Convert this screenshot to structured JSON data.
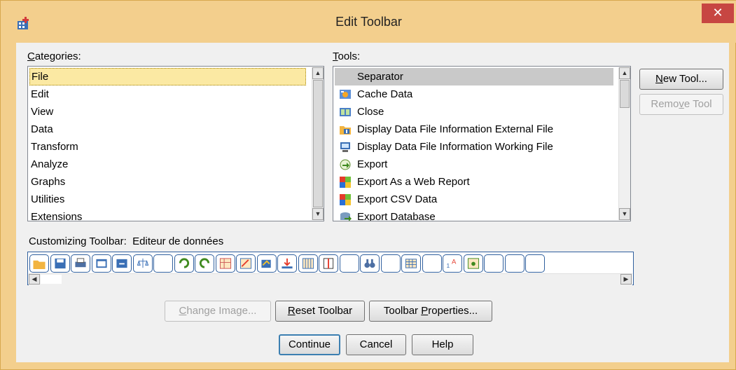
{
  "window": {
    "title": "Edit Toolbar",
    "close_glyph": "✕",
    "app_icon": "spss-toolbar-icon",
    "accent": "#f3cf8d"
  },
  "categories": {
    "label_underlined": "C",
    "label_rest": "ategories:",
    "items": [
      "File",
      "Edit",
      "View",
      "Data",
      "Transform",
      "Analyze",
      "Graphs",
      "Utilities",
      "Extensions"
    ],
    "selected": "File"
  },
  "tools": {
    "label_underlined": "T",
    "label_rest": "ools:",
    "items": [
      {
        "label": "Separator",
        "icon": "separator-icon"
      },
      {
        "label": "Cache Data",
        "icon": "cache-data-icon"
      },
      {
        "label": "Close",
        "icon": "close-file-icon"
      },
      {
        "label": "Display Data File Information External File",
        "icon": "folder-info-icon"
      },
      {
        "label": "Display Data File Information Working File",
        "icon": "monitor-info-icon"
      },
      {
        "label": "Export",
        "icon": "export-icon"
      },
      {
        "label": "Export As a Web Report",
        "icon": "web-report-icon"
      },
      {
        "label": "Export CSV Data",
        "icon": "csv-export-icon"
      },
      {
        "label": "Export Database",
        "icon": "database-export-icon"
      }
    ],
    "selected": "Separator"
  },
  "side_buttons": {
    "new_tool_underlined": "N",
    "new_tool_rest": "ew Tool...",
    "remove_tool_pre": "Remo",
    "remove_tool_underlined": "v",
    "remove_tool_rest": "e Tool"
  },
  "customizing": {
    "label": "Customizing Toolbar:",
    "value": "Editeur de données"
  },
  "bottom_buttons": {
    "change_image_underlined": "C",
    "change_image_rest": "hange Image...",
    "reset_toolbar_underlined": "R",
    "reset_toolbar_rest": "eset Toolbar",
    "toolbar_properties_pre": "Toolbar ",
    "toolbar_properties_underlined": "P",
    "toolbar_properties_rest": "roperties...",
    "continue": "Continue",
    "cancel": "Cancel",
    "help": "Help"
  },
  "scroll_glyphs": {
    "up": "▲",
    "down": "▼",
    "left": "◀",
    "right": "▶"
  }
}
